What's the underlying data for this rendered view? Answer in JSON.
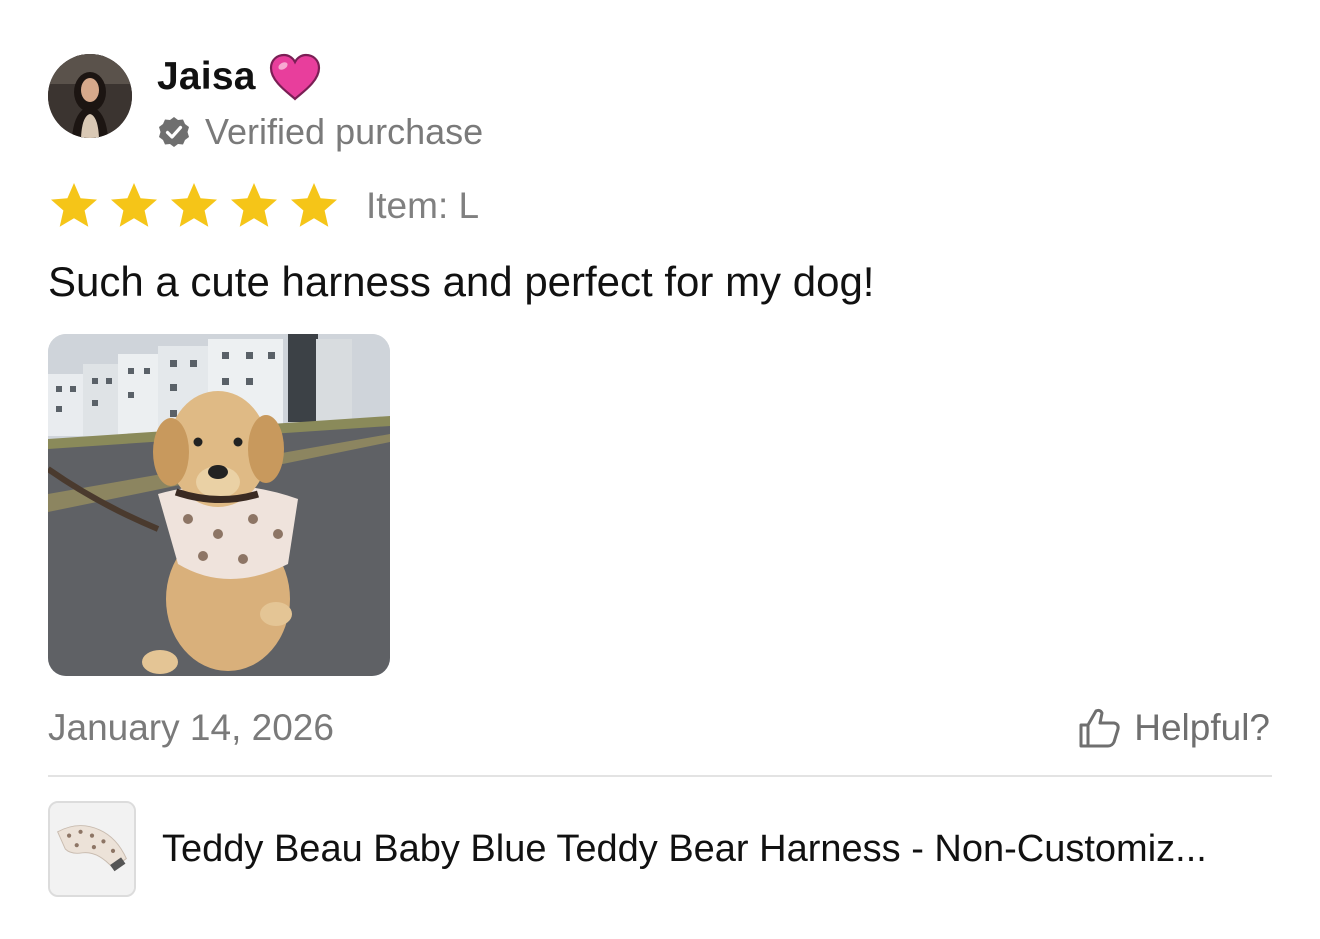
{
  "review": {
    "author": "Jaisa",
    "author_badge_icon": "pink-heart-icon",
    "verified_label": "Verified purchase",
    "rating": 5,
    "rating_max": 5,
    "star_color": "#F5C518",
    "item_label": "Item: L",
    "text": "Such a cute harness and perfect for my dog!",
    "date": "January 14, 2026",
    "helpful_label": "Helpful?"
  },
  "product": {
    "name": "Teddy Beau Baby Blue Teddy Bear Harness - Non-Customiz..."
  },
  "colors": {
    "heart": "#E83E9C",
    "muted_text": "#7a7a7a",
    "divider": "#e3e3e3"
  }
}
